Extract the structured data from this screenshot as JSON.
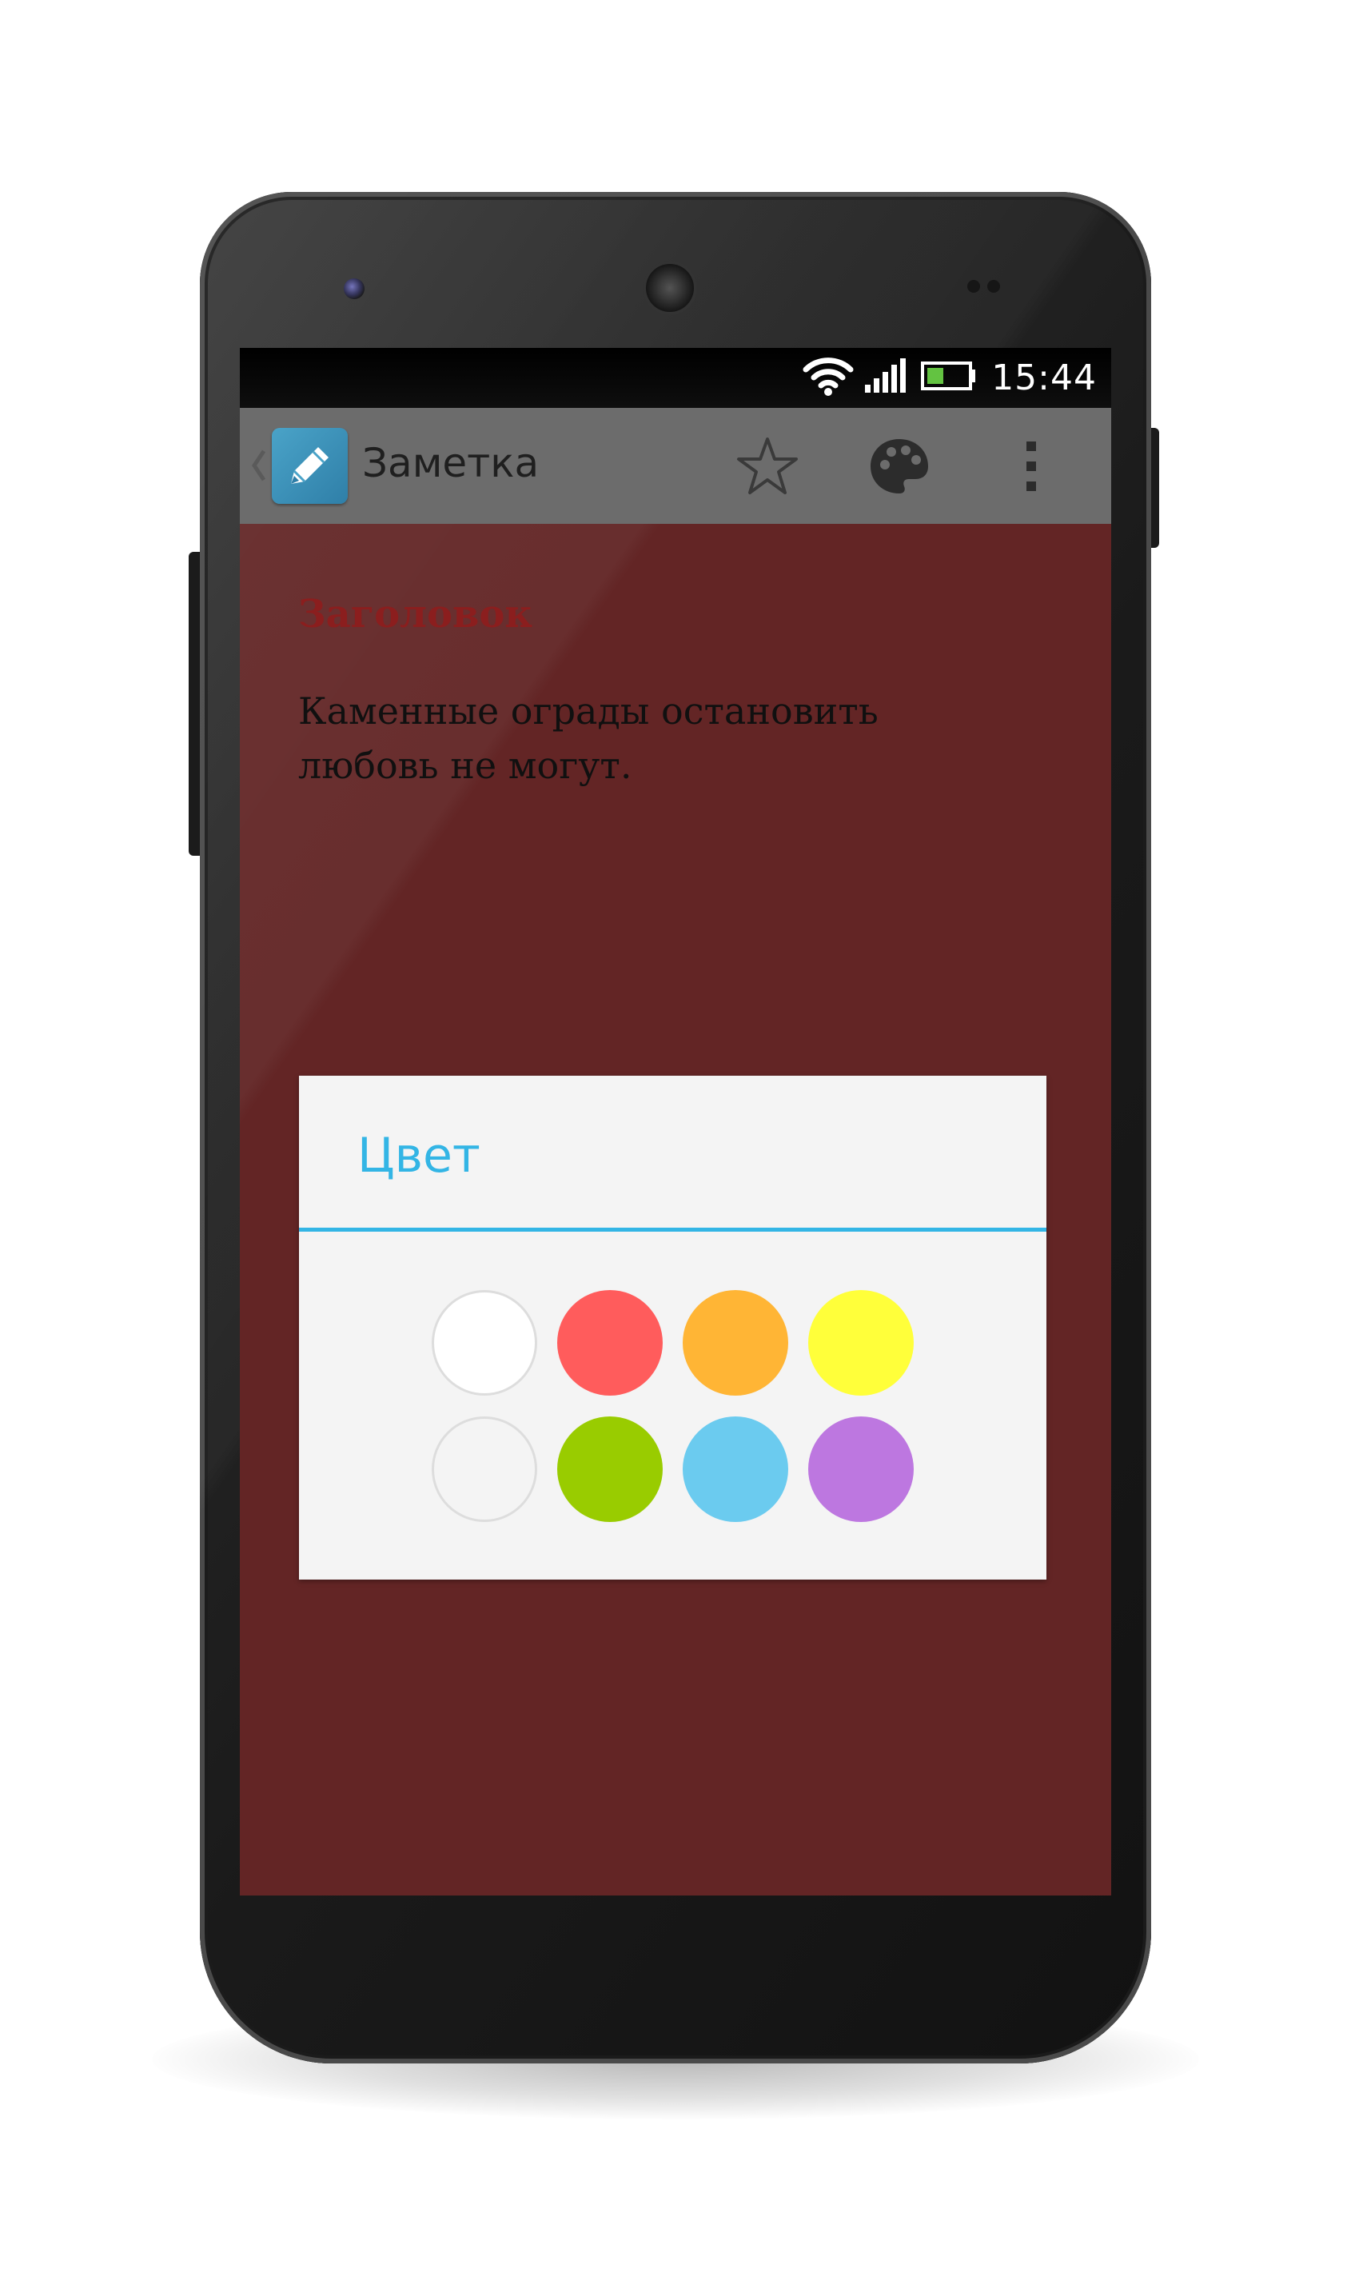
{
  "status_bar": {
    "time": "15:44"
  },
  "action_bar": {
    "title": "Заметка",
    "icons": [
      "back-chevron-icon",
      "pencil-app-icon",
      "star-icon",
      "palette-icon",
      "overflow-menu-icon"
    ]
  },
  "note": {
    "heading_placeholder": "Заголовок",
    "body": "Каменные ограды остановить любовь не могут."
  },
  "dialog": {
    "title": "Цвет",
    "swatches": [
      {
        "name": "white",
        "color": "#ffffff"
      },
      {
        "name": "red",
        "color": "#ff5c5c"
      },
      {
        "name": "orange",
        "color": "#ffb535"
      },
      {
        "name": "yellow",
        "color": "#ffff3a"
      },
      {
        "name": "light-gray",
        "color": "#f4f4f4"
      },
      {
        "name": "green",
        "color": "#99cc00"
      },
      {
        "name": "blue",
        "color": "#6bcbef"
      },
      {
        "name": "purple",
        "color": "#bd77e0"
      }
    ]
  },
  "colors": {
    "note_background": "#652626",
    "accent": "#33b5e5",
    "heading": "#8e1f1f",
    "action_bar": "#6c6c6c"
  }
}
